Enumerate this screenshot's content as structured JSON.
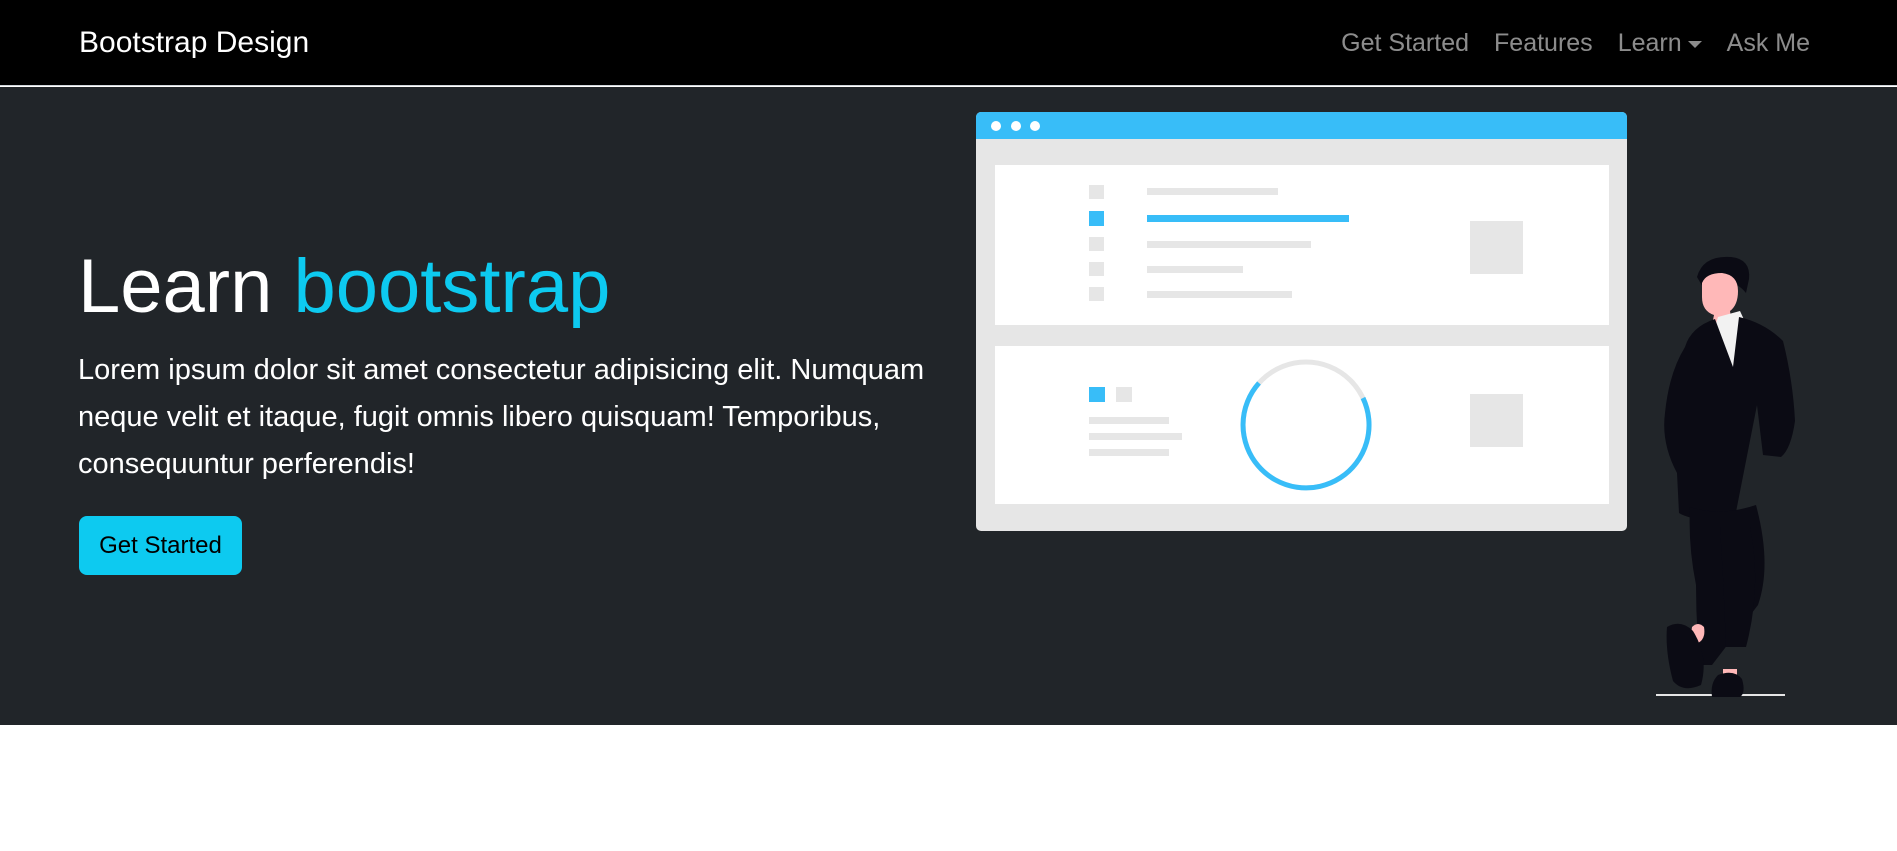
{
  "navbar": {
    "brand": "Bootstrap Design",
    "links": [
      {
        "label": "Get Started"
      },
      {
        "label": "Features"
      },
      {
        "label": "Learn",
        "dropdown": true
      },
      {
        "label": "Ask Me"
      }
    ]
  },
  "hero": {
    "title_main": "Learn ",
    "title_accent": "bootstrap",
    "lead": "Lorem ipsum dolor sit amet consectetur adipisicing elit. Numquam neque velit et itaque, fugit omnis libero quisquam! Temporibus, consequuntur perferendis!",
    "cta_label": "Get Started"
  },
  "illustration": {
    "description_icon": "dashboard-with-man-illustration",
    "accent_color": "#38bdf8"
  },
  "colors": {
    "navbar_bg": "#000000",
    "hero_bg": "#212529",
    "accent": "#0dcaf0",
    "nav_link": "rgba(255,255,255,0.55)"
  }
}
